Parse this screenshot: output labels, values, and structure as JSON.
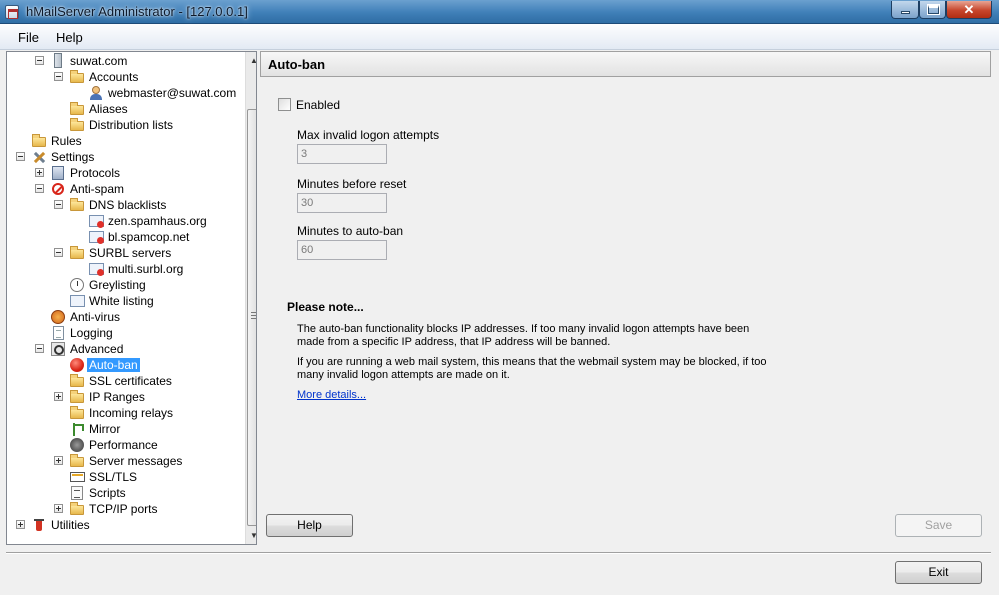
{
  "window": {
    "title": "hMailServer Administrator - [127.0.0.1]"
  },
  "menu": {
    "items": [
      "File",
      "Help"
    ]
  },
  "tree": {
    "items": [
      {
        "label": "suwat.com"
      },
      {
        "label": "Accounts"
      },
      {
        "label": "webmaster@suwat.com"
      },
      {
        "label": "Aliases"
      },
      {
        "label": "Distribution lists"
      },
      {
        "label": "Rules"
      },
      {
        "label": "Settings"
      },
      {
        "label": "Protocols"
      },
      {
        "label": "Anti-spam"
      },
      {
        "label": "DNS blacklists"
      },
      {
        "label": "zen.spamhaus.org"
      },
      {
        "label": "bl.spamcop.net"
      },
      {
        "label": "SURBL servers"
      },
      {
        "label": "multi.surbl.org"
      },
      {
        "label": "Greylisting"
      },
      {
        "label": "White listing"
      },
      {
        "label": "Anti-virus"
      },
      {
        "label": "Logging"
      },
      {
        "label": "Advanced"
      },
      {
        "label": "Auto-ban",
        "selected": true
      },
      {
        "label": "SSL certificates"
      },
      {
        "label": "IP Ranges"
      },
      {
        "label": "Incoming relays"
      },
      {
        "label": "Mirror"
      },
      {
        "label": "Performance"
      },
      {
        "label": "Server messages"
      },
      {
        "label": "SSL/TLS"
      },
      {
        "label": "Scripts"
      },
      {
        "label": "TCP/IP ports"
      },
      {
        "label": "Utilities"
      }
    ]
  },
  "panel": {
    "title": "Auto-ban",
    "enabled_label": "Enabled",
    "enabled_checked": false,
    "fields": [
      {
        "label": "Max invalid logon attempts",
        "value": "3"
      },
      {
        "label": "Minutes before reset",
        "value": "30"
      },
      {
        "label": "Minutes to auto-ban",
        "value": "60"
      }
    ],
    "note_title": "Please note...",
    "note_paragraphs": [
      "The auto-ban functionality blocks IP addresses. If too many invalid logon attempts have been made from a specific IP address, that IP address will be banned.",
      "If you are running a web mail system, this means that the webmail system may be blocked, if too many invalid logon attempts are made on it."
    ],
    "more_details": "More details...",
    "help_button": "Help",
    "save_button": "Save"
  },
  "footer": {
    "exit_button": "Exit"
  },
  "icons": {
    "tree": [
      "server-icon",
      "folder-icon",
      "user-icon",
      "folder-icon",
      "folder-icon",
      "folder-icon",
      "tools-icon",
      "protocols-icon",
      "anti-spam-icon",
      "folder-icon",
      "blacklist-icon",
      "blacklist-icon",
      "folder-icon",
      "blacklist-icon",
      "greylisting-icon",
      "whitelist-icon",
      "anti-virus-icon",
      "logging-icon",
      "advanced-icon",
      "auto-ban-icon",
      "folder-icon",
      "folder-icon",
      "folder-icon",
      "mirror-icon",
      "performance-icon",
      "folder-icon",
      "ssl-tls-icon",
      "scripts-icon",
      "folder-icon",
      "utilities-icon"
    ]
  },
  "colors": {
    "selection": "#3399ff",
    "link": "#0033cc",
    "titlebar": "#3f7fb8"
  }
}
